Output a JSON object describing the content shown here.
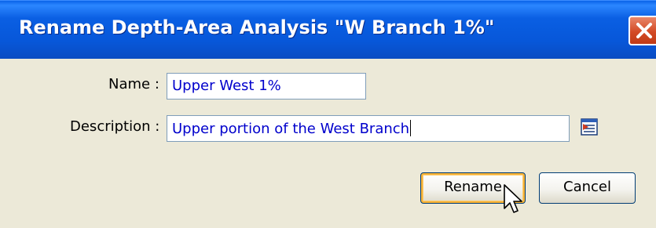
{
  "window": {
    "title": "Rename Depth-Area Analysis \"W Branch 1%\"",
    "close_icon": "close-icon"
  },
  "form": {
    "name_label": "Name :",
    "name_value": "Upper West 1%",
    "description_label": "Description :",
    "description_value": "Upper portion of the West Branch",
    "browse_icon": "notes-icon"
  },
  "buttons": {
    "rename": "Rename",
    "cancel": "Cancel"
  },
  "colors": {
    "titlebar": "#0A5FE3",
    "dialog_bg": "#ECE9D8",
    "field_text": "#0000CC",
    "close_button": "#D34A25",
    "default_button_focus": "#F8B336"
  }
}
